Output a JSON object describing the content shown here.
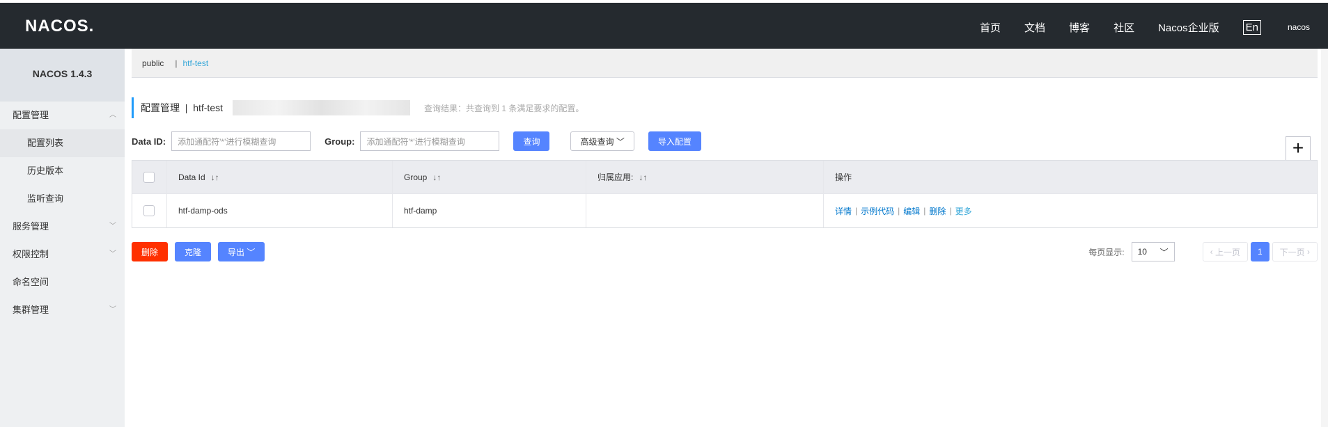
{
  "header": {
    "logo": "NACOS.",
    "nav": [
      "首页",
      "文档",
      "博客",
      "社区",
      "Nacos企业版"
    ],
    "lang": "En",
    "user": "nacos"
  },
  "sidebar": {
    "version": "NACOS 1.4.3",
    "items": [
      {
        "label": "配置管理",
        "level": 1,
        "expanded": true
      },
      {
        "label": "配置列表",
        "level": 2,
        "active": true
      },
      {
        "label": "历史版本",
        "level": 2
      },
      {
        "label": "监听查询",
        "level": 2
      },
      {
        "label": "服务管理",
        "level": 1
      },
      {
        "label": "权限控制",
        "level": 1
      },
      {
        "label": "命名空间",
        "level": 1
      },
      {
        "label": "集群管理",
        "level": 1
      }
    ]
  },
  "namespace_bar": {
    "public": "public",
    "separator": "|",
    "current": "htf-test"
  },
  "page": {
    "title": "配置管理",
    "separator": "|",
    "namespace": "htf-test",
    "result_text": "查询结果：共查询到 1 条满足要求的配置。"
  },
  "search": {
    "data_id_label": "Data ID:",
    "data_id_placeholder": "添加通配符'*'进行模糊查询",
    "group_label": "Group:",
    "group_placeholder": "添加通配符'*'进行模糊查询",
    "query_button": "查询",
    "advanced_button": "高级查询",
    "import_button": "导入配置",
    "add_button": "+"
  },
  "table": {
    "headers": [
      "Data Id",
      "Group",
      "归属应用:",
      "操作"
    ],
    "rows": [
      {
        "data_id": "htf-damp-ods",
        "group": "htf-damp",
        "app": "",
        "ops": [
          "详情",
          "示例代码",
          "编辑",
          "删除",
          "更多"
        ]
      }
    ]
  },
  "bulk": {
    "delete": "删除",
    "clone": "克隆",
    "export": "导出"
  },
  "pagination": {
    "page_size_label": "每页显示:",
    "page_size": "10",
    "prev": "上一页",
    "current": "1",
    "next": "下一页"
  },
  "colors": {
    "topbar": "#252a2f",
    "primary": "#5584ff",
    "danger": "#ff3000",
    "link": "#0077cc",
    "accent": "#209bfa"
  }
}
